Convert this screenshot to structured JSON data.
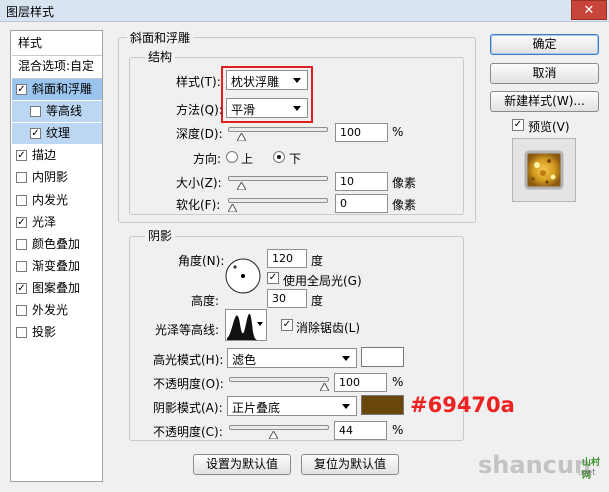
{
  "window": {
    "title": "图层样式",
    "close_glyph": "✕"
  },
  "sidebar": {
    "header": "样式",
    "blend_options": "混合选项:自定",
    "items": [
      {
        "label": "斜面和浮雕",
        "checked": true,
        "state": "selected",
        "indent": false
      },
      {
        "label": "等高线",
        "checked": false,
        "state": "sub",
        "indent": true
      },
      {
        "label": "纹理",
        "checked": true,
        "state": "sub",
        "indent": true
      },
      {
        "label": "描边",
        "checked": true,
        "state": "",
        "indent": false
      },
      {
        "label": "内阴影",
        "checked": false,
        "state": "",
        "indent": false
      },
      {
        "label": "内发光",
        "checked": false,
        "state": "",
        "indent": false
      },
      {
        "label": "光泽",
        "checked": true,
        "state": "",
        "indent": false
      },
      {
        "label": "颜色叠加",
        "checked": false,
        "state": "",
        "indent": false
      },
      {
        "label": "渐变叠加",
        "checked": false,
        "state": "",
        "indent": false
      },
      {
        "label": "图案叠加",
        "checked": true,
        "state": "",
        "indent": false
      },
      {
        "label": "外发光",
        "checked": false,
        "state": "",
        "indent": false
      },
      {
        "label": "投影",
        "checked": false,
        "state": "",
        "indent": false
      }
    ]
  },
  "bevel": {
    "title": "斜面和浮雕",
    "structure_title": "结构",
    "style_label": "样式(T):",
    "style_value": "枕状浮雕",
    "technique_label": "方法(Q):",
    "technique_value": "平滑",
    "depth_label": "深度(D):",
    "depth_value": "100",
    "depth_pct": "%",
    "direction_label": "方向:",
    "direction_up": "上",
    "direction_down": "下",
    "direction_selected": "down",
    "size_label": "大小(Z):",
    "size_value": "10",
    "size_unit": "像素",
    "soften_label": "软化(F):",
    "soften_value": "0",
    "soften_unit": "像素"
  },
  "shading": {
    "title": "阴影",
    "angle_label": "角度(N):",
    "angle_value": "120",
    "angle_unit": "度",
    "global_light_label": "使用全局光(G)",
    "global_light_checked": true,
    "altitude_label": "高度:",
    "altitude_value": "30",
    "altitude_unit": "度",
    "gloss_contour_label": "光泽等高线:",
    "antialiased_label": "消除锯齿(L)",
    "antialiased_checked": true,
    "highlight_mode_label": "高光模式(H):",
    "highlight_mode_value": "滤色",
    "highlight_color": "#ffffff",
    "highlight_opacity_label": "不透明度(O):",
    "highlight_opacity_value": "100",
    "highlight_opacity_pct": "%",
    "shadow_mode_label": "阴影模式(A):",
    "shadow_mode_value": "正片叠底",
    "shadow_color": "#69470a",
    "shadow_opacity_label": "不透明度(C):",
    "shadow_opacity_value": "44",
    "shadow_opacity_pct": "%",
    "annotation": "#69470a"
  },
  "slider_levels": {
    "depth": 0.1,
    "size": 0.1,
    "soften": 0.0,
    "highlight_opacity": 1.0,
    "shadow_opacity": 0.44
  },
  "footer": {
    "make_default": "设置为默认值",
    "reset_default": "复位为默认值"
  },
  "right_panel": {
    "ok": "确定",
    "cancel": "取消",
    "new_style": "新建样式(W)...",
    "preview_label": "预览(V)",
    "preview_checked": true
  },
  "watermark": {
    "logo": "shancun",
    "suffix": ".net",
    "sub": "山村网"
  },
  "colors": {
    "selection": "#9bc5ef",
    "annotation_red": "#ec2121",
    "watermark_green": "#3c8f2c"
  }
}
